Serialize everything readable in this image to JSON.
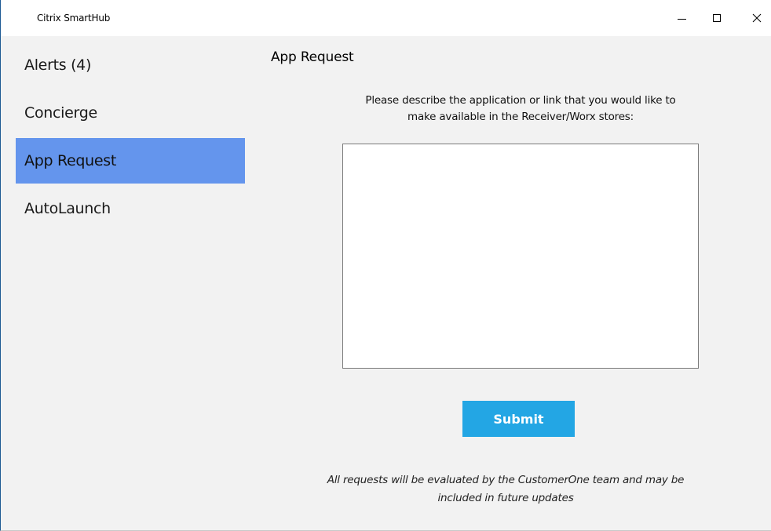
{
  "window": {
    "title": "Citrix SmartHub"
  },
  "sidebar": {
    "items": [
      {
        "label": "Alerts (4)",
        "active": false
      },
      {
        "label": "Concierge",
        "active": false
      },
      {
        "label": "App Request",
        "active": true
      },
      {
        "label": "AutoLaunch",
        "active": false
      }
    ]
  },
  "main": {
    "title": "App Request",
    "description_line1": "Please describe the application or link that you would like to",
    "description_line2": "make available in the Receiver/Worx stores:",
    "request_value": "",
    "submit_label": "Submit",
    "footer_line1": "All requests will be evaluated by the CustomerOne team and may be",
    "footer_line2": "included in future updates"
  },
  "colors": {
    "active_nav": "#6495ed",
    "submit_button": "#23a6e4",
    "window_background": "#f2f2f2"
  }
}
